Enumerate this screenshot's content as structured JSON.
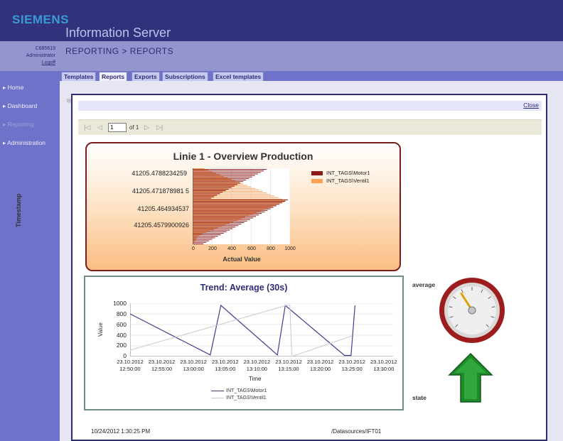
{
  "header": {
    "brand": "SIEMENS",
    "app_title": "Information Server"
  },
  "user": {
    "id": "C685619",
    "role": "Administrator",
    "logoff": "Logoff"
  },
  "nav": {
    "items": [
      {
        "label": "Home",
        "dim": false
      },
      {
        "label": "Dashboard",
        "dim": false
      },
      {
        "label": "Reporting",
        "dim": true
      },
      {
        "label": "Administration",
        "dim": false
      }
    ]
  },
  "breadcrumb": "REPORTING > REPORTS",
  "tabs": [
    "Templates",
    "Reports",
    "Exports",
    "Subscriptions",
    "Excel templates"
  ],
  "active_tab": "Reports",
  "report": {
    "close": "Close",
    "pager": {
      "current_page": "1",
      "of_label": "of 1"
    },
    "footer_left": "10/24/2012 1:30:25 PM",
    "footer_right": "/Datasources/IFT01",
    "average_label": "average",
    "state_label": "state"
  },
  "colors": {
    "header": "#30337b",
    "sidebar": "#6f72c9",
    "band": "#9494cf",
    "motor_bar": "#8b1a1a",
    "ventil_bar": "#f7a35c",
    "trend_motor": "#3f3f8f",
    "trend_ventil": "#c9c9c9",
    "arrow": "#1f8a2a",
    "gauge_ring": "#9d1c1c"
  },
  "chart_data": [
    {
      "type": "bar",
      "orientation": "horizontal",
      "title": "Linie 1 - Overview Production",
      "ylabel": "Timestamp",
      "xlabel": "Actual Value",
      "xlim": [
        0,
        1000
      ],
      "x_ticks": [
        "0",
        "200",
        "400",
        "600",
        "800",
        "1000"
      ],
      "y_ticks": [
        "41205.4788234259",
        "41205.471878981 5",
        "41205.464934537",
        "41205.4579900926"
      ],
      "legend": "right",
      "series": [
        {
          "name": "INT_TAGS\\Motor1",
          "values": [
            760,
            730,
            700,
            670,
            640,
            610,
            580,
            550,
            520,
            490,
            460,
            430,
            400,
            370,
            340,
            310,
            280,
            250,
            220,
            190,
            980,
            950,
            920,
            890,
            860,
            830,
            800,
            770,
            740,
            710,
            680,
            650,
            620,
            590,
            560,
            530,
            500,
            470,
            440,
            410,
            380,
            350,
            320,
            290,
            260,
            230,
            200,
            170,
            140,
            110
          ]
        },
        {
          "name": "INT_TAGS\\Ventil1",
          "values": [
            120,
            160,
            200,
            240,
            280,
            320,
            360,
            400,
            440,
            480,
            520,
            560,
            600,
            640,
            680,
            720,
            760,
            800,
            840,
            880,
            920,
            960,
            940,
            900,
            860,
            820,
            780,
            740,
            700,
            660,
            620,
            580,
            540,
            500,
            460,
            420,
            380,
            340,
            300,
            260,
            220,
            180,
            140,
            100,
            70,
            50,
            40,
            30,
            20,
            10
          ]
        }
      ]
    },
    {
      "type": "line",
      "title": "Trend: Average (30s)",
      "ylabel": "Value",
      "xlabel": "Time",
      "ylim": [
        0,
        1000
      ],
      "y_ticks": [
        "1000",
        "800",
        "600",
        "400",
        "200",
        "0"
      ],
      "x_ticks": [
        [
          "23.10.2012",
          "12:50:00"
        ],
        [
          "23.10.2012",
          "12:55:00"
        ],
        [
          "23.10.2012",
          "13:00:00"
        ],
        [
          "23.10.2012",
          "13:05:00"
        ],
        [
          "23.10.2012",
          "13:10:00"
        ],
        [
          "23.10.2012",
          "13:15:00"
        ],
        [
          "23.10.2012",
          "13:20:00"
        ],
        [
          "23.10.2012",
          "13:25:00"
        ],
        [
          "23.10.2012",
          "13:30:00"
        ]
      ],
      "legend": "bottom",
      "series": [
        {
          "name": "INT_TAGS\\Motor1",
          "minutes": [
            0,
            12.2,
            13.8,
            22.4,
            23.6,
            32.6,
            33.6,
            34.2
          ],
          "values": [
            800,
            30,
            960,
            30,
            960,
            20,
            20,
            960
          ]
        },
        {
          "name": "INT_TAGS\\Ventil1",
          "minutes": [
            0,
            23.8,
            24.3,
            24.6,
            33.8
          ],
          "values": [
            120,
            960,
            960,
            0,
            390
          ]
        }
      ]
    },
    {
      "type": "gauge",
      "label": "average",
      "min": 0,
      "max": 1000,
      "value": 380
    }
  ]
}
